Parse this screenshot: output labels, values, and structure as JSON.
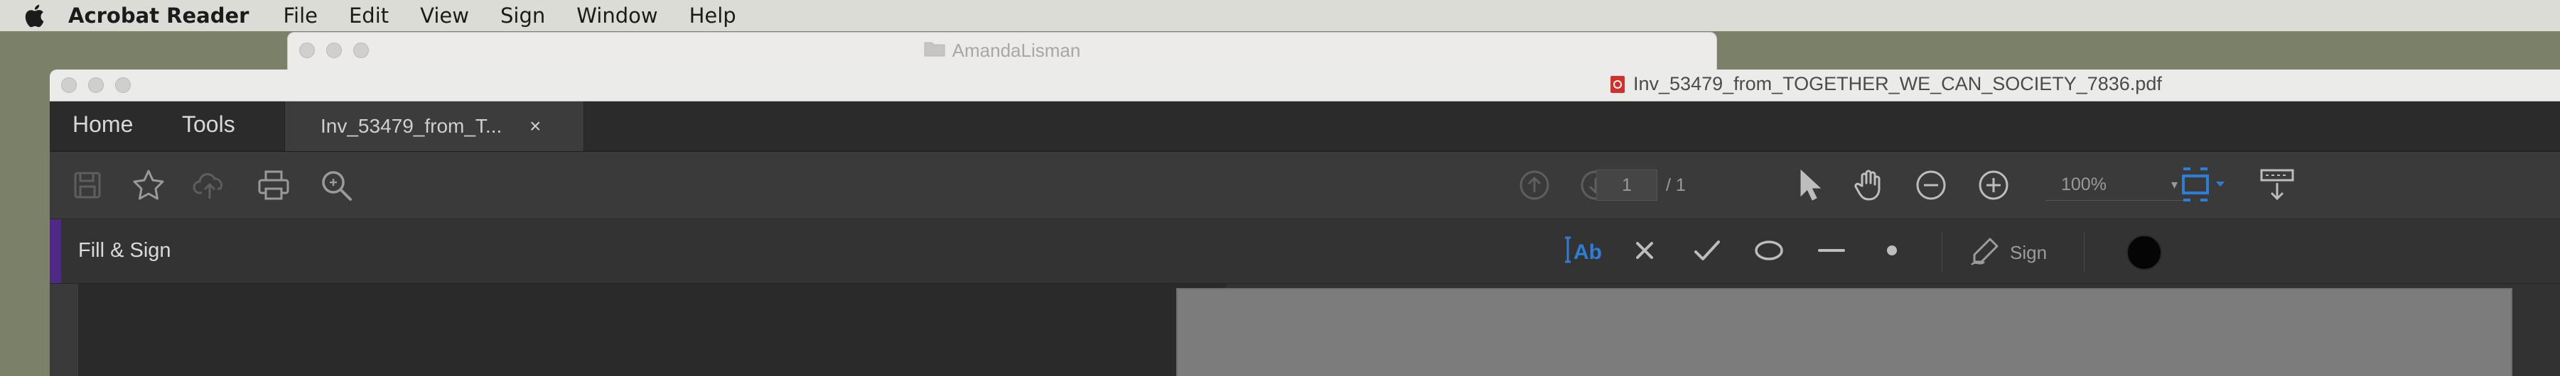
{
  "menubar": {
    "app_name": "Acrobat Reader",
    "items": [
      "File",
      "Edit",
      "View",
      "Sign",
      "Window",
      "Help"
    ]
  },
  "background_window": {
    "title": "AmandaLisman"
  },
  "window": {
    "title": "Inv_53479_from_TOGETHER_WE_CAN_SOCIETY_7836.pdf"
  },
  "tabs": {
    "home": "Home",
    "tools": "Tools",
    "document_tab": "Inv_53479_from_T...",
    "close": "×"
  },
  "toolbar": {
    "current_page": "1",
    "page_total": "/ 1",
    "zoom": "100%",
    "zoom_caret": "▾"
  },
  "fill_sign": {
    "title": "Fill & Sign",
    "sign_label": "Sign",
    "text_tool_label": "Ab",
    "current_color": "#000000",
    "accent_color": "#4e2a86",
    "icons": [
      "text-field-icon",
      "cross-mark-icon",
      "checkmark-icon",
      "ellipse-icon",
      "line-icon",
      "dot-icon",
      "pen-sign-icon"
    ]
  }
}
